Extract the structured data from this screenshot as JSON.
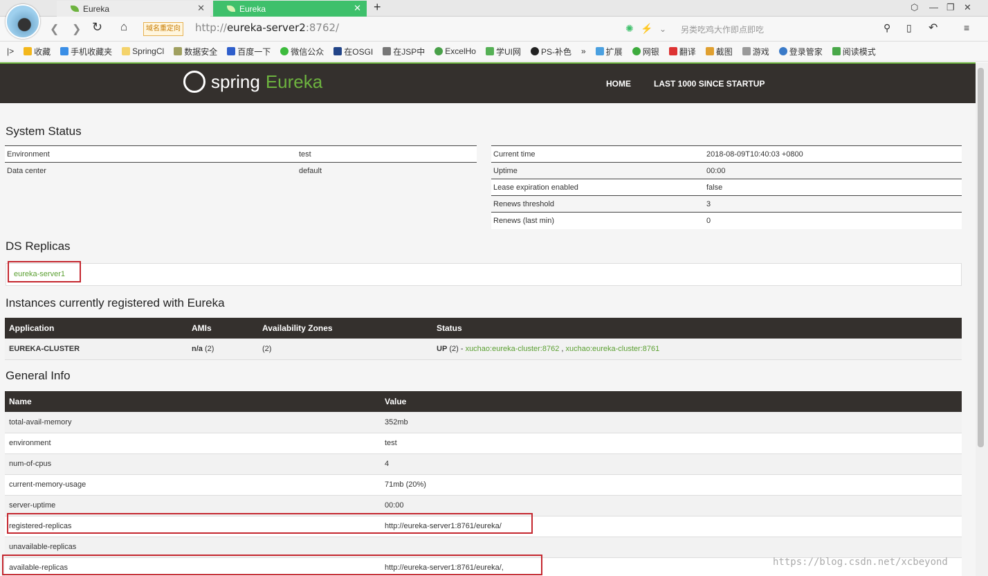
{
  "browser": {
    "tabs": [
      {
        "label": "Eureka"
      },
      {
        "label": "Eureka"
      }
    ],
    "redirect_badge": "域名重定向",
    "url_host": "eureka-server2",
    "url_prefix": "http://",
    "url_port": ":8762/",
    "search_placeholder": "另类吃鸡大作即点即吃",
    "bookmarks": [
      "收藏",
      "手机收藏夹",
      "SpringCl",
      "数据安全",
      "百度一下",
      "微信公众",
      "在OSGI",
      "在JSP中",
      "ExcelHo",
      "学UI网",
      "PS-补色",
      "»",
      "扩展",
      "网银",
      "翻译",
      "截图",
      "游戏",
      "登录管家",
      "阅读模式"
    ]
  },
  "header": {
    "brand1": "spring",
    "brand2": "Eureka",
    "nav_home": "HOME",
    "nav_last": "LAST 1000 SINCE STARTUP"
  },
  "system_status": {
    "title": "System Status",
    "left": [
      {
        "k": "Environment",
        "v": "test"
      },
      {
        "k": "Data center",
        "v": "default"
      }
    ],
    "right": [
      {
        "k": "Current time",
        "v": "2018-08-09T10:40:03 +0800"
      },
      {
        "k": "Uptime",
        "v": "00:00"
      },
      {
        "k": "Lease expiration enabled",
        "v": "false"
      },
      {
        "k": "Renews threshold",
        "v": "3"
      },
      {
        "k": "Renews (last min)",
        "v": "0"
      }
    ]
  },
  "ds_replicas": {
    "title": "DS Replicas",
    "link": "eureka-server1"
  },
  "instances": {
    "title": "Instances currently registered with Eureka",
    "headers": [
      "Application",
      "AMIs",
      "Availability Zones",
      "Status"
    ],
    "row": {
      "app": "EUREKA-CLUSTER",
      "ami": "n/a",
      "ami_count": " (2)",
      "zones": "(2)",
      "status": "UP",
      "status_count": " (2) - ",
      "link1": "xuchao:eureka-cluster:8762",
      "sep": " , ",
      "link2": "xuchao:eureka-cluster:8761"
    }
  },
  "general_info": {
    "title": "General Info",
    "headers": [
      "Name",
      "Value"
    ],
    "rows": [
      {
        "k": "total-avail-memory",
        "v": "352mb"
      },
      {
        "k": "environment",
        "v": "test"
      },
      {
        "k": "num-of-cpus",
        "v": "4"
      },
      {
        "k": "current-memory-usage",
        "v": "71mb (20%)"
      },
      {
        "k": "server-uptime",
        "v": "00:00"
      },
      {
        "k": "registered-replicas",
        "v": "http://eureka-server1:8761/eureka/"
      },
      {
        "k": "unavailable-replicas",
        "v": ""
      },
      {
        "k": "available-replicas",
        "v": "http://eureka-server1:8761/eureka/,"
      }
    ]
  },
  "watermark": "https://blog.csdn.net/xcbeyond",
  "colors": {
    "brand_green": "#6db33f",
    "header_dark": "#34302d",
    "highlight_red": "#c4262e"
  }
}
